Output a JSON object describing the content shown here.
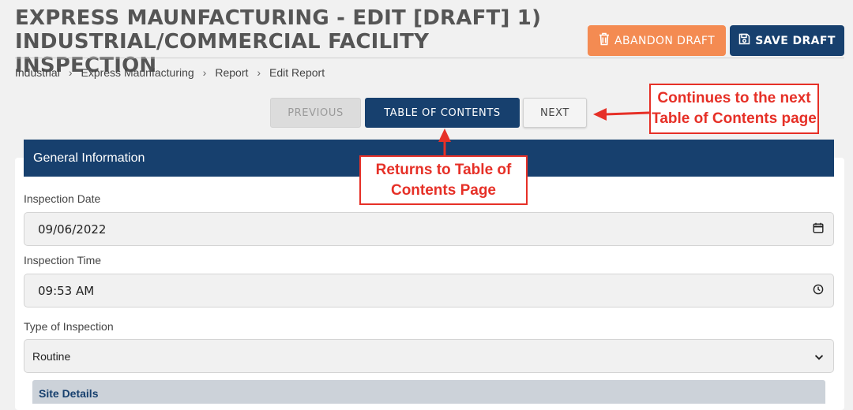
{
  "header": {
    "title_line1": "EXPRESS MAUNFACTURING - EDIT [DRAFT] 1)",
    "title_line2": "INDUSTRIAL/COMMERCIAL FACILITY INSPECTION",
    "abandon_label": "ABANDON DRAFT",
    "save_label": "SAVE DRAFT",
    "abandon_icon": "trash-icon",
    "save_icon": "floppy-disk-icon"
  },
  "breadcrumb": [
    "Industrial",
    "Express Maunfacturing",
    "Report",
    "Edit Report"
  ],
  "nav": {
    "previous": "PREVIOUS",
    "toc": "TABLE OF CONTENTS",
    "next": "NEXT"
  },
  "section": {
    "title": "General Information",
    "fields": {
      "inspection_date": {
        "label": "Inspection Date",
        "value": "09/06/2022",
        "icon": "calendar-icon"
      },
      "inspection_time": {
        "label": "Inspection Time",
        "value": "09:53 AM",
        "icon": "clock-icon"
      },
      "inspection_type": {
        "label": "Type of Inspection",
        "value": "Routine",
        "icon": "chevron-down-icon"
      }
    },
    "subsection_title": "Site Details"
  },
  "annotations": {
    "next_callout": [
      "Continues to the next",
      "Table of Contents page"
    ],
    "toc_callout": [
      "Returns to Table of",
      "Contents Page"
    ],
    "color": "#e63027"
  },
  "colors": {
    "primary": "#17406e",
    "warning": "#f48b52",
    "background": "#f1f1f1"
  }
}
